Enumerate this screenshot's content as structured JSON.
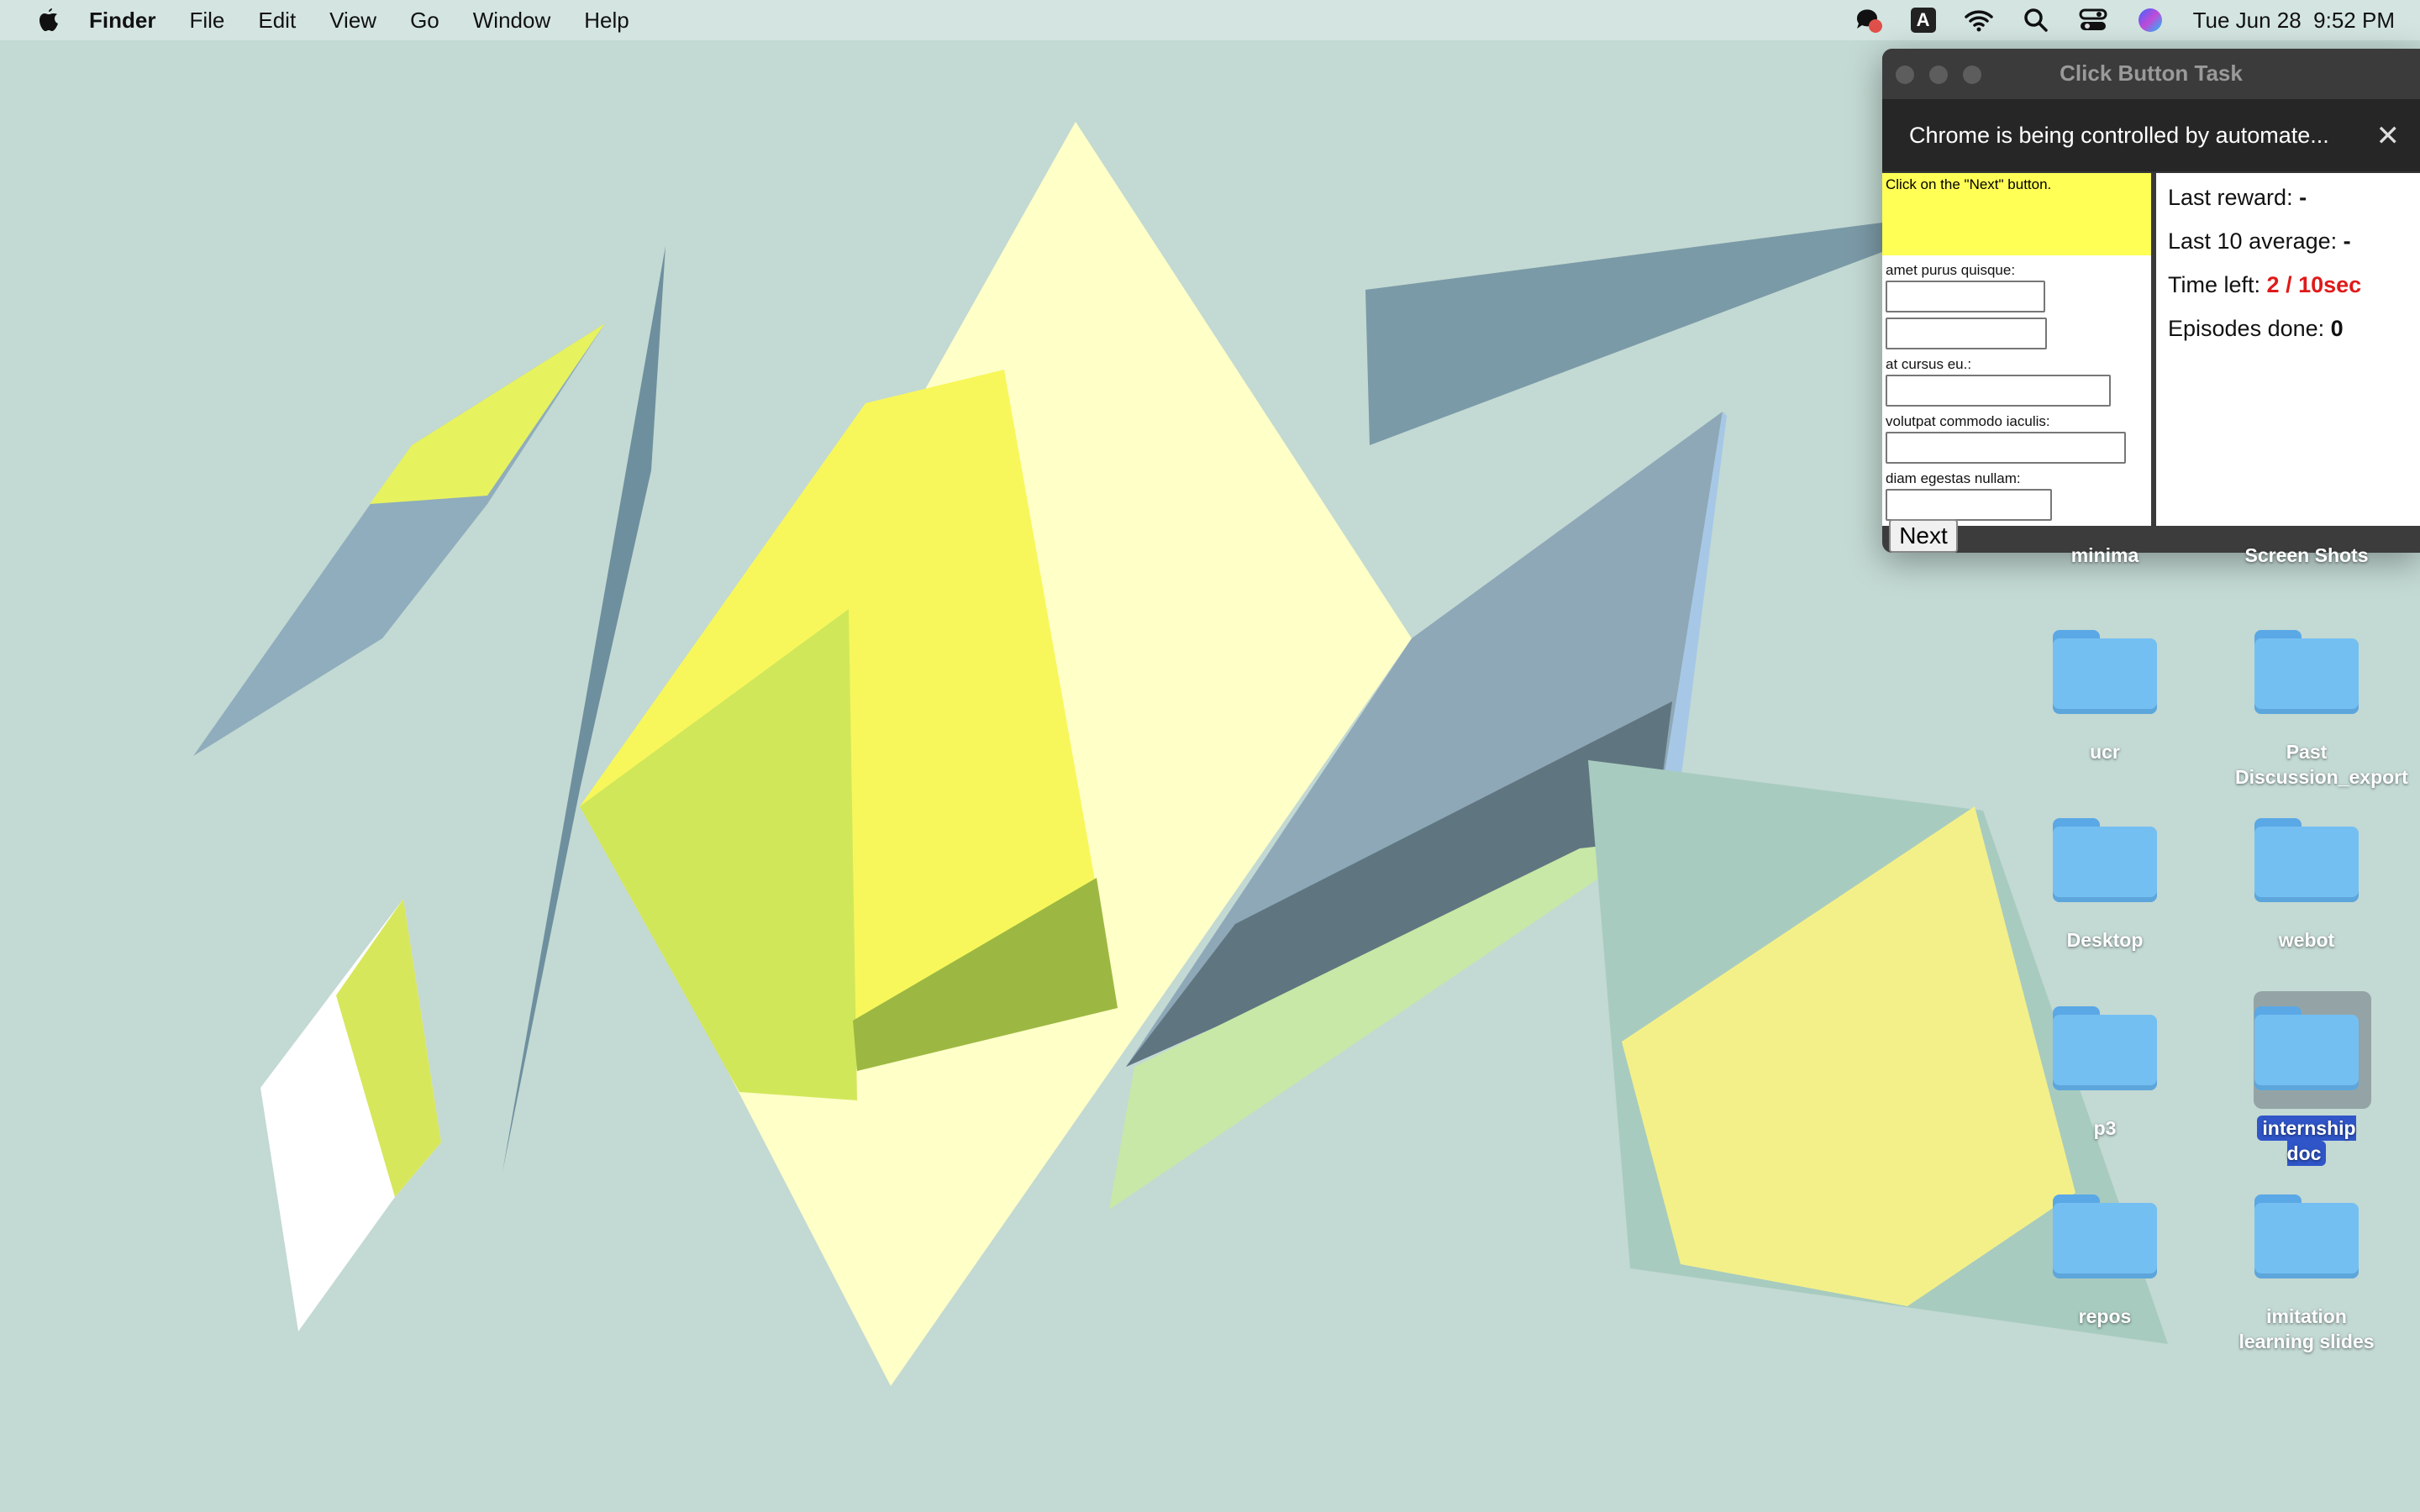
{
  "menubar": {
    "apple_icon": "apple-logo-icon",
    "items": [
      "Finder",
      "File",
      "Edit",
      "View",
      "Go",
      "Window",
      "Help"
    ],
    "status_icons": [
      "notification-icon",
      "input-source-icon",
      "wifi-icon",
      "spotlight-search-icon",
      "control-center-icon",
      "siri-icon"
    ],
    "input_source_label": "A",
    "datetime": "Tue Jun 28  9:52 PM"
  },
  "window": {
    "title": "Click Button Task",
    "infobar_text": "Chrome is being controlled by automate...",
    "infobar_close": "✕"
  },
  "task": {
    "instruction": "Click on the \"Next\" button.",
    "fields": [
      {
        "label": "amet purus quisque:"
      },
      {
        "label": ""
      },
      {
        "label": "at cursus eu.:"
      },
      {
        "label": "volutpat commodo iaculis:"
      },
      {
        "label": "diam egestas nullam:"
      }
    ],
    "next_label": "Next"
  },
  "stats": {
    "last_reward_label": "Last reward:",
    "last_reward_value": "-",
    "last10_label": "Last 10 average:",
    "last10_value": "-",
    "time_left_label": "Time left:",
    "time_left_value": "2 / 10sec",
    "episodes_label": "Episodes done:",
    "episodes_value": "0"
  },
  "desktop": {
    "partial_labels": [
      "minima",
      "Screen Shots"
    ],
    "icons": [
      {
        "label": "ucr"
      },
      {
        "label": "Past Discussion_export"
      },
      {
        "label": "Desktop"
      },
      {
        "label": "webot"
      },
      {
        "label": "p3"
      },
      {
        "label": "internship doc",
        "selected": true
      },
      {
        "label": "repos"
      },
      {
        "label": "imitation learning slides"
      }
    ]
  }
}
